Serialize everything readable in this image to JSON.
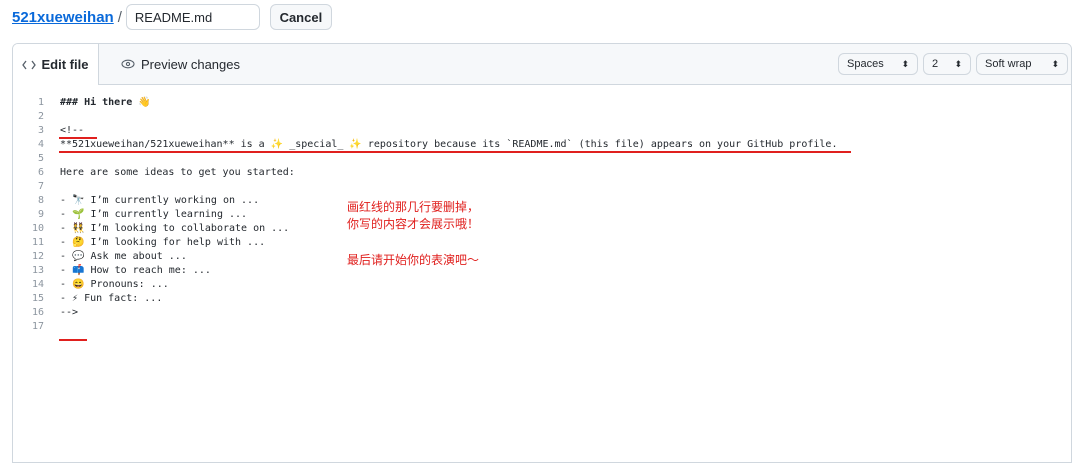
{
  "header": {
    "owner": "521xueweihan",
    "separator": "/",
    "filename_value": "README.md",
    "cancel_label": "Cancel"
  },
  "tabs": {
    "edit_label": "Edit file",
    "edit_icon": "code-icon",
    "preview_label": "Preview changes",
    "preview_icon": "eye-icon"
  },
  "controls": {
    "indent_mode": "Spaces",
    "indent_size": "2",
    "wrap_mode": "Soft wrap"
  },
  "code_lines": [
    {
      "n": "1",
      "text": "### Hi there 👋"
    },
    {
      "n": "2",
      "text": ""
    },
    {
      "n": "3",
      "text": "<!--"
    },
    {
      "n": "4",
      "text": "**521xueweihan/521xueweihan** is a ✨ _special_ ✨ repository because its `README.md` (this file) appears on your GitHub profile."
    },
    {
      "n": "5",
      "text": ""
    },
    {
      "n": "6",
      "text": "Here are some ideas to get you started:"
    },
    {
      "n": "7",
      "text": ""
    },
    {
      "n": "8",
      "text": "- 🔭 I’m currently working on ..."
    },
    {
      "n": "9",
      "text": "- 🌱 I’m currently learning ..."
    },
    {
      "n": "10",
      "text": "- 👯 I’m looking to collaborate on ..."
    },
    {
      "n": "11",
      "text": "- 🤔 I’m looking for help with ..."
    },
    {
      "n": "12",
      "text": "- 💬 Ask me about ..."
    },
    {
      "n": "13",
      "text": "- 📫 How to reach me: ..."
    },
    {
      "n": "14",
      "text": "- 😄 Pronouns: ..."
    },
    {
      "n": "15",
      "text": "- ⚡ Fun fact: ..."
    },
    {
      "n": "16",
      "text": "-->"
    },
    {
      "n": "17",
      "text": ""
    }
  ],
  "annotation": {
    "line1": "画红线的那几行要删掉，",
    "line2": "你写的内容才会展示哦！",
    "line3": "最后请开始你的表演吧～",
    "color": "#e0201e"
  },
  "colors": {
    "link": "#0969da",
    "border": "#d0d7de",
    "tab_bg": "#f6f8fa",
    "annotation_red": "#e0201e"
  }
}
